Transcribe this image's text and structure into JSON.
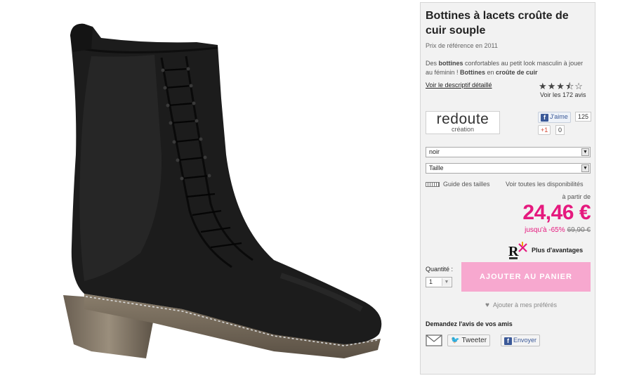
{
  "product": {
    "title": "Bottines à lacets croûte de cuir souple",
    "reference_price": "Prix de référence en 2011",
    "description": {
      "part1": "Des ",
      "bold1": "bottines",
      "part2": " confortables au petit look masculin à jouer au féminin ! ",
      "bold2": "Bottines",
      "part3": " en ",
      "bold3": "croûte de cuir"
    },
    "details_link": "Voir le descriptif détaillé",
    "rating": {
      "stars": 3.5,
      "max": 5,
      "display": "★★★⯪☆"
    },
    "reviews_link": "Voir les 172 avis"
  },
  "brand": {
    "name": "redoute",
    "sub": "création"
  },
  "social": {
    "like_label": "J'aime",
    "like_count": "125",
    "gplus_label": "+1",
    "gplus_count": "0"
  },
  "selects": {
    "color": "noir",
    "size": "Taille"
  },
  "links": {
    "size_guide": "Guide des tailles",
    "availability": "Voir toutes les disponibilités"
  },
  "pricing": {
    "from_label": "à partir de",
    "price": "24,46 €",
    "discount": "jusqu'à -65%",
    "old_price": "69,90 €"
  },
  "advantages": "Plus d'avantages",
  "quantity": {
    "label": "Quantité :",
    "value": "1"
  },
  "cart": {
    "button": "AJOUTER AU PANIER"
  },
  "favorites": "Ajouter à mes préférés",
  "share": {
    "title": "Demandez l'avis de vos amis",
    "tweet": "Tweeter",
    "send": "Envoyer"
  },
  "colors": {
    "accent": "#e5197e",
    "cart_button": "#f7a8cf",
    "facebook": "#3b5998"
  }
}
